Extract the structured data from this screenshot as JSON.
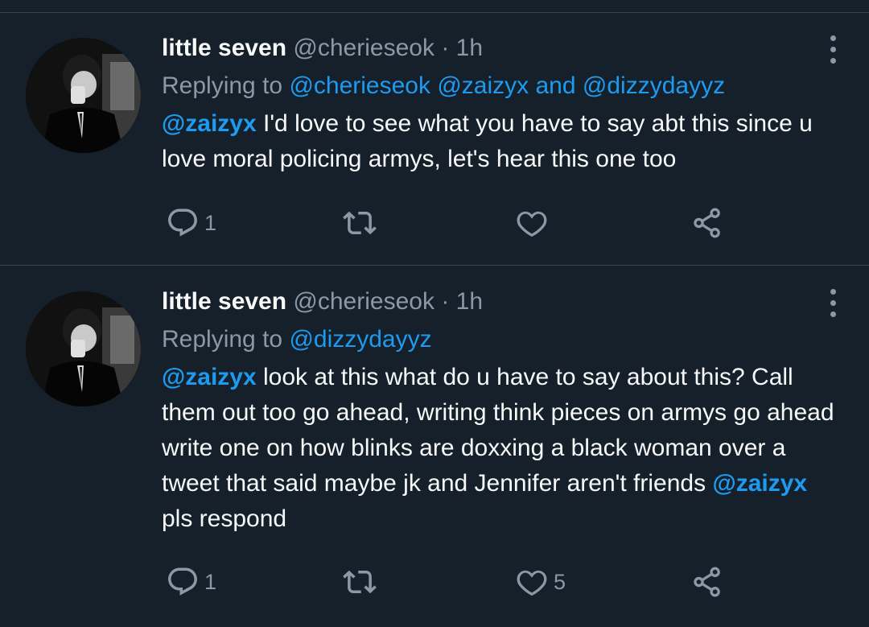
{
  "tweets": [
    {
      "name": "little seven",
      "handle": "@cherieseok",
      "time": "· 1h",
      "reply_prefix": "Replying to",
      "reply_handles": [
        "@cherieseok",
        "@zaizyx"
      ],
      "reply_and": "and",
      "reply_last": "@dizzydayyz",
      "body_mention": "@zaizyx",
      "body_text": " I'd love to see what you have to say abt this since u love moral policing armys, let's hear this one too",
      "replies": "1",
      "retweets": "",
      "likes": "",
      "icons": [
        "more-icon",
        "reply-icon",
        "retweet-icon",
        "like-icon",
        "share-icon"
      ]
    },
    {
      "name": "little seven",
      "handle": "@cherieseok",
      "time": "· 1h",
      "reply_prefix": "Replying to",
      "reply_last": "@dizzydayyz",
      "body_mention": "@zaizyx",
      "body_text": " look at this what do u have to say about this? Call them out too go ahead, writing think pieces on armys go ahead write one on how blinks are doxxing a black woman over a tweet that said maybe jk and Jennifer aren't friends ",
      "body_mention_2": "@zaizyx",
      "body_text_2": " pls respond",
      "replies": "1",
      "retweets": "",
      "likes": "5",
      "icons": [
        "more-icon",
        "reply-icon",
        "retweet-icon",
        "like-icon",
        "share-icon"
      ]
    }
  ],
  "colors": {
    "background": "#15202b",
    "text": "#f7f9f9",
    "muted": "#8b98a5",
    "accent": "#1d9bf0",
    "divider": "#38444d"
  }
}
